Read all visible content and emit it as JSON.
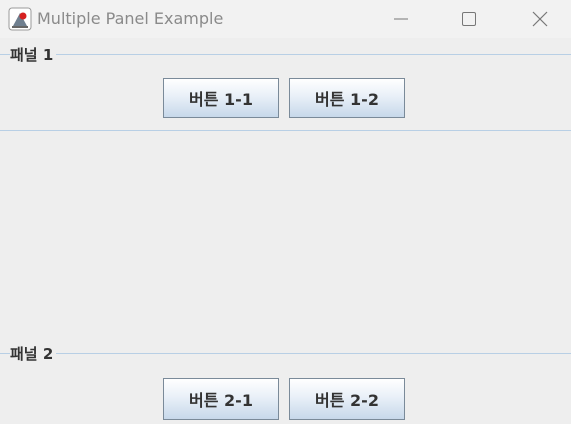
{
  "window": {
    "title": "Multiple Panel Example",
    "app_icon": "java-coffee-icon",
    "controls": {
      "minimize_icon": "minimize-icon",
      "maximize_icon": "maximize-icon",
      "close_icon": "close-icon"
    }
  },
  "panels": [
    {
      "title": "패널 1",
      "buttons": [
        {
          "label": "버튼 1-1"
        },
        {
          "label": "버튼 1-2"
        }
      ]
    },
    {
      "title": "패널 2",
      "buttons": [
        {
          "label": "버튼 2-1"
        },
        {
          "label": "버튼 2-2"
        }
      ]
    }
  ],
  "colors": {
    "background": "#eeeeee",
    "titlebar": "#f2f2f2",
    "border_line": "#b8cfe5",
    "text": "#333333"
  }
}
